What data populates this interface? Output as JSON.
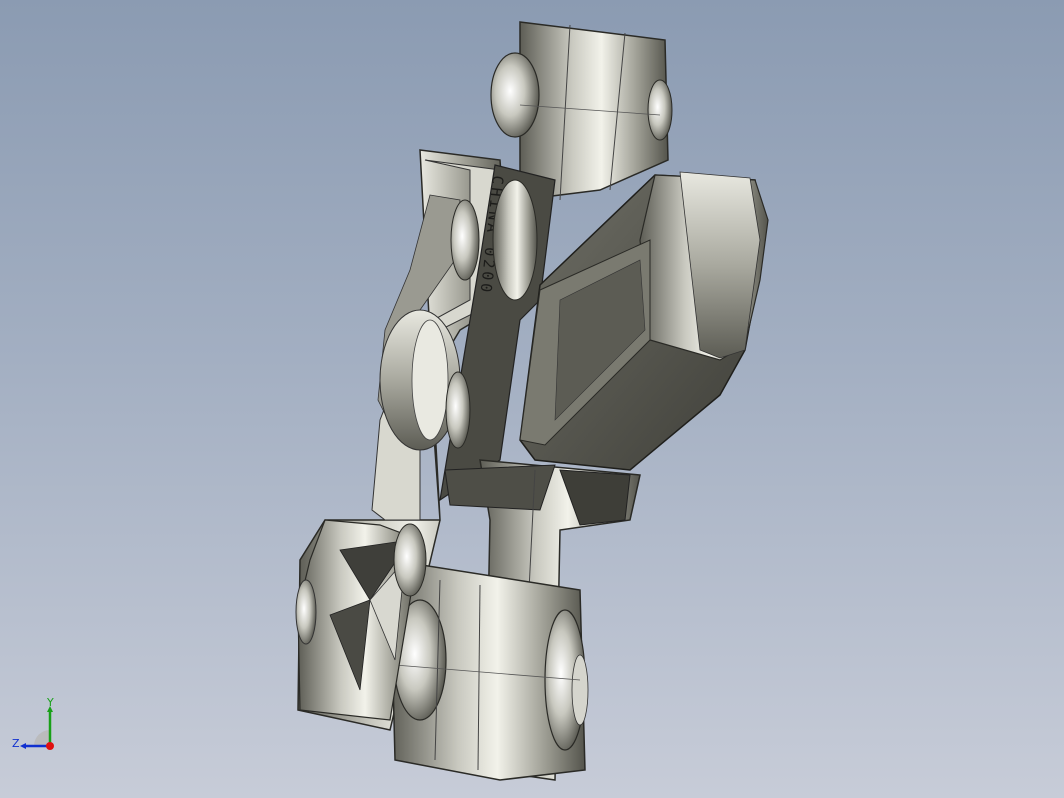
{
  "viewport": {
    "background_top": "#8b9bb2",
    "background_bottom": "#c7ccd8",
    "part_engraving": "CHINA 0200"
  },
  "triad": {
    "y_label": "Y",
    "z_label": "Z",
    "x_axis_color": "#e01010",
    "y_axis_color": "#18a018",
    "z_axis_color": "#1030d0"
  }
}
